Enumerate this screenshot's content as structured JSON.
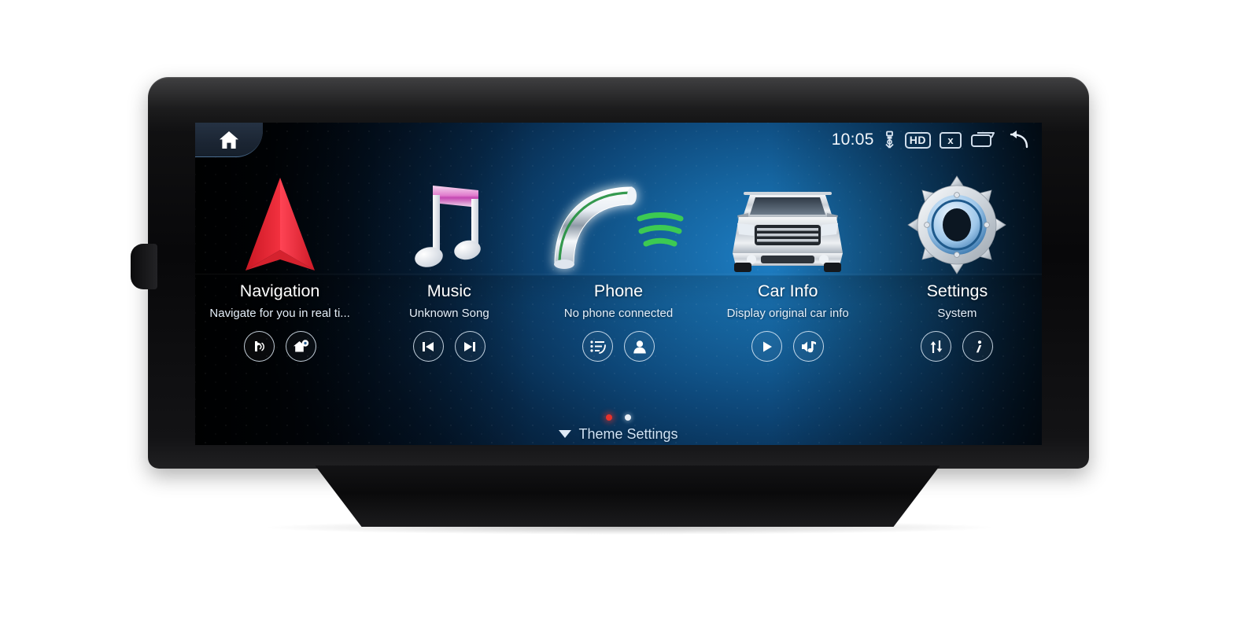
{
  "device": {
    "type": "car-head-unit-display",
    "knob": "left-side-button"
  },
  "status_bar": {
    "home_icon": "home-icon",
    "clock": "10:05",
    "icons": [
      {
        "name": "usb-icon",
        "label": "USB"
      },
      {
        "name": "hd-badge",
        "label": "HD"
      },
      {
        "name": "mute-close-icon",
        "label": "x"
      },
      {
        "name": "recents-windows-icon",
        "label": ""
      },
      {
        "name": "back-arrow-icon",
        "label": ""
      }
    ]
  },
  "apps": [
    {
      "id": "navigation",
      "title": "Navigation",
      "subtitle": "Navigate for you in real ti...",
      "art": "red-navigation-arrow",
      "controls": [
        {
          "name": "voice-guidance-button",
          "icon": "navigation-voice-icon"
        },
        {
          "name": "go-home-button",
          "icon": "home-on-map-icon"
        }
      ]
    },
    {
      "id": "music",
      "title": "Music",
      "subtitle": "Unknown Song",
      "art": "pink-music-note",
      "controls": [
        {
          "name": "previous-track-button",
          "icon": "skip-previous-icon"
        },
        {
          "name": "next-track-button",
          "icon": "skip-next-icon"
        }
      ]
    },
    {
      "id": "phone",
      "title": "Phone",
      "subtitle": "No phone connected",
      "art": "chrome-handset-with-green-waves",
      "controls": [
        {
          "name": "call-log-button",
          "icon": "dial-list-icon"
        },
        {
          "name": "contacts-button",
          "icon": "person-icon"
        }
      ]
    },
    {
      "id": "car-info",
      "title": "Car Info",
      "subtitle": "Display original car info",
      "art": "silver-suv-front",
      "controls": [
        {
          "name": "play-button",
          "icon": "play-icon"
        },
        {
          "name": "car-sound-button",
          "icon": "music-note-speaker-icon"
        }
      ]
    },
    {
      "id": "settings",
      "title": "Settings",
      "subtitle": "System",
      "art": "silver-gear-blue-ring",
      "controls": [
        {
          "name": "data-transfer-button",
          "icon": "up-down-arrows-icon"
        },
        {
          "name": "about-info-button",
          "icon": "info-italic-icon"
        }
      ]
    }
  ],
  "pager": {
    "pages": 2,
    "active_index": 0,
    "active_color": "#e8322c",
    "inactive_color": "#e8eef5"
  },
  "bottom_bar": {
    "theme_settings_label": "Theme Settings",
    "caret": "chevron-down-icon"
  },
  "colors": {
    "screen_blue": "#15649f",
    "nav_red": "#e8322c",
    "music_pink": "#e08ad0",
    "phone_green": "#34c759",
    "gear_blue": "#7fb4e4"
  }
}
